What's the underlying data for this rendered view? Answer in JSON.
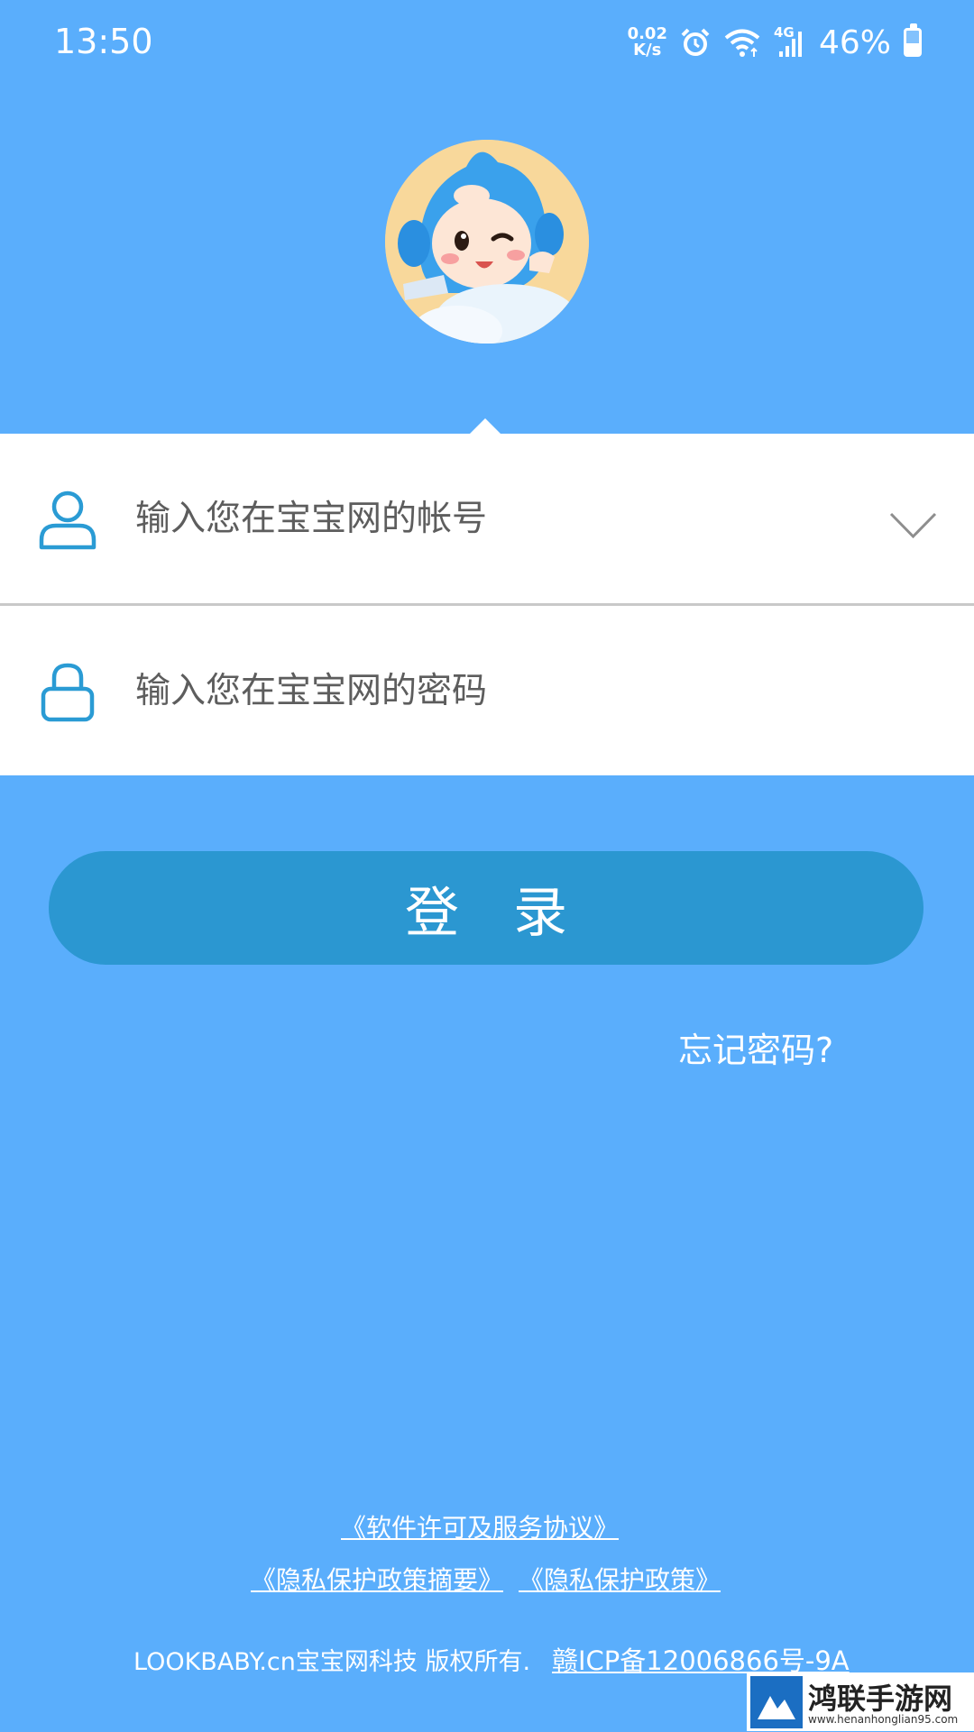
{
  "status_bar": {
    "time": "13:50",
    "net_speed_value": "0.02",
    "net_speed_unit": "K/s",
    "network_type": "4G",
    "battery_percent": "46%",
    "battery_level": 0.46,
    "icons": [
      "alarm-icon",
      "wifi-icon",
      "signal-icon",
      "battery-icon"
    ]
  },
  "login_form": {
    "account_placeholder": "输入您在宝宝网的帐号",
    "password_placeholder": "输入您在宝宝网的密码",
    "login_label": "登录",
    "forgot_password": "忘记密码?"
  },
  "footer": {
    "license_link": "《软件许可及服务协议》",
    "privacy_summary_link": "《隐私保护政策摘要》",
    "privacy_policy_link": "《隐私保护政策》",
    "copyright": "LOOKBABY.cn宝宝网科技 版权所有.",
    "icp": "赣ICP备12006866号-9A"
  },
  "watermark": {
    "name": "鸿联手游网",
    "url": "www.henanhonglian95.com"
  },
  "colors": {
    "background": "#5aaefc",
    "button": "#2b97d1",
    "icon": "#2a9bd4",
    "panel": "#ffffff"
  }
}
